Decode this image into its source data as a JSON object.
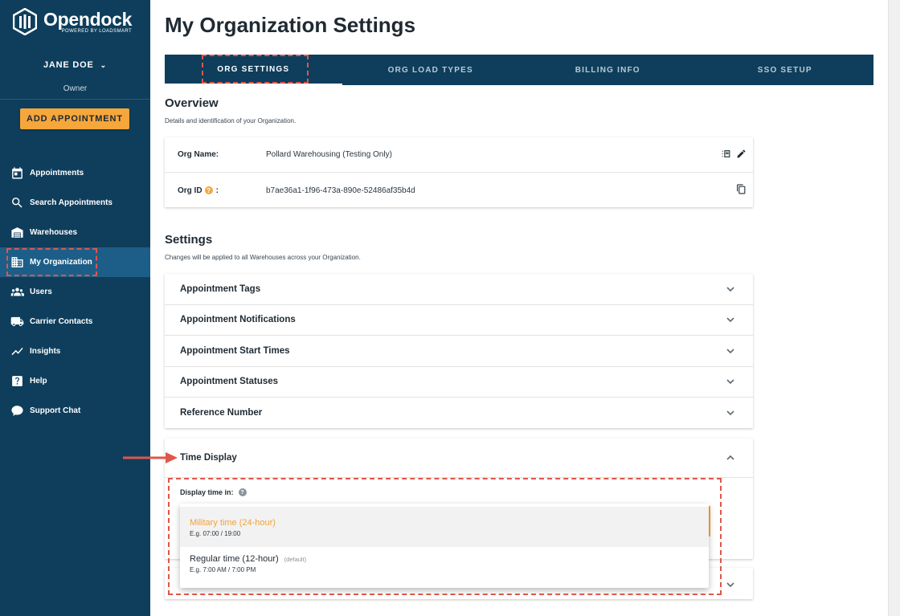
{
  "brand": {
    "name": "Opendock",
    "tagline": "POWERED BY LOADSMART"
  },
  "user": {
    "name": "JANE DOE",
    "role": "Owner"
  },
  "sidebar": {
    "add_button": "ADD APPOINTMENT",
    "items": [
      {
        "label": "Appointments",
        "icon": "calendar-icon"
      },
      {
        "label": "Search Appointments",
        "icon": "search-icon"
      },
      {
        "label": "Warehouses",
        "icon": "warehouse-icon"
      },
      {
        "label": "My Organization",
        "icon": "building-icon",
        "active": true
      },
      {
        "label": "Users",
        "icon": "users-icon"
      },
      {
        "label": "Carrier Contacts",
        "icon": "truck-icon"
      },
      {
        "label": "Insights",
        "icon": "chart-line-icon"
      },
      {
        "label": "Help",
        "icon": "help-icon"
      },
      {
        "label": "Support Chat",
        "icon": "chat-icon"
      }
    ]
  },
  "page": {
    "title": "My Organization Settings"
  },
  "tabs": [
    {
      "label": "ORG SETTINGS",
      "active": true
    },
    {
      "label": "ORG LOAD TYPES"
    },
    {
      "label": "BILLING INFO"
    },
    {
      "label": "SSO SETUP"
    }
  ],
  "overview": {
    "title": "Overview",
    "subtitle": "Details and identification of your Organization.",
    "org_name_label": "Org Name:",
    "org_name_value": "Pollard Warehousing (Testing Only)",
    "org_id_label": "Org ID",
    "org_id_suffix": ":",
    "org_id_value": "b7ae36a1-1f96-473a-890e-52486af35b4d"
  },
  "settings": {
    "title": "Settings",
    "subtitle": "Changes will be applied to all Warehouses across your Organization.",
    "items": [
      "Appointment Tags",
      "Appointment Notifications",
      "Appointment Start Times",
      "Appointment Statuses",
      "Reference Number"
    ],
    "time_display": {
      "title": "Time Display",
      "field_label": "Display time in:",
      "options": [
        {
          "title": "Military time (24-hour)",
          "example": "E.g. 07:00 / 19:00",
          "selected": true
        },
        {
          "title": "Regular time (12-hour)",
          "tag": "(default)",
          "example": "E.g. 7:00 AM / 7:00 PM"
        }
      ]
    }
  },
  "colors": {
    "navy": "#0e3e5c",
    "accent": "#f6a73b",
    "highlight": "#e0564a",
    "active_nav": "#1c5e87"
  }
}
